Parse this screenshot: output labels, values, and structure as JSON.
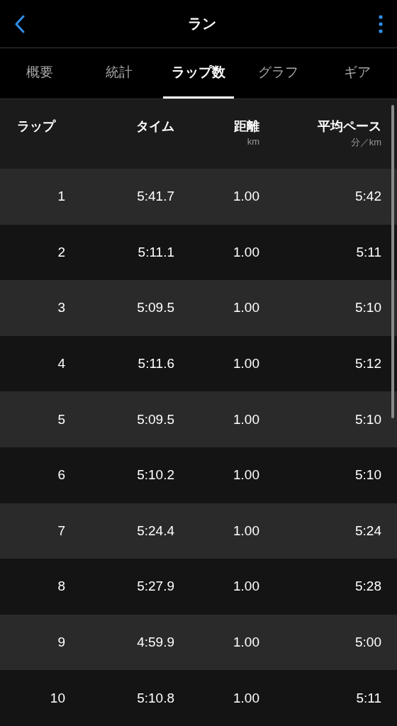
{
  "header": {
    "title": "ラン"
  },
  "tabs": [
    {
      "label": "概要",
      "selected": false
    },
    {
      "label": "統計",
      "selected": false
    },
    {
      "label": "ラップ数",
      "selected": true
    },
    {
      "label": "グラフ",
      "selected": false
    },
    {
      "label": "ギア",
      "selected": false
    }
  ],
  "table": {
    "columns": [
      {
        "label": "ラップ"
      },
      {
        "label": "タイム"
      },
      {
        "label": "距離",
        "unit": "km"
      },
      {
        "label": "平均ペース",
        "unit": "分／km"
      }
    ],
    "rows": [
      [
        "1",
        "5:41.7",
        "1.00",
        "5:42"
      ],
      [
        "2",
        "5:11.1",
        "1.00",
        "5:11"
      ],
      [
        "3",
        "5:09.5",
        "1.00",
        "5:10"
      ],
      [
        "4",
        "5:11.6",
        "1.00",
        "5:12"
      ],
      [
        "5",
        "5:09.5",
        "1.00",
        "5:10"
      ],
      [
        "6",
        "5:10.2",
        "1.00",
        "5:10"
      ],
      [
        "7",
        "5:24.4",
        "1.00",
        "5:24"
      ],
      [
        "8",
        "5:27.9",
        "1.00",
        "5:28"
      ],
      [
        "9",
        "4:59.9",
        "1.00",
        "5:00"
      ],
      [
        "10",
        "5:10.8",
        "1.00",
        "5:11"
      ]
    ]
  }
}
